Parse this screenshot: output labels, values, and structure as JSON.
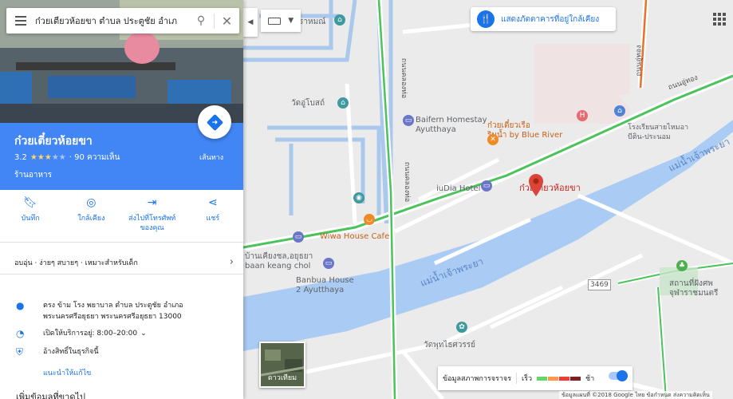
{
  "search": {
    "value": "ก๋วยเตี๋ยวห้อยขา ตำบล ประตูชัย อำเภ",
    "placeholder": ""
  },
  "place": {
    "name": "ก๋วยเตี๋ยวห้อยขา",
    "rating": "3.2",
    "stars": "★★★",
    "stars_off": "★★",
    "reviews": "· 90 ความเห็น",
    "category": "ร้านอาหาร",
    "directions_label": "เส้นทาง"
  },
  "actions": [
    {
      "label": "บันทึก",
      "icon": "bookmark-icon"
    },
    {
      "label": "ใกล้เคียง",
      "icon": "nearby-icon"
    },
    {
      "label": "ส่งไปที่โทรศัพท์ของคุณ",
      "icon": "send-to-phone-icon"
    },
    {
      "label": "แชร์",
      "icon": "share-icon"
    }
  ],
  "tags": "อบอุ่น · ง่ายๆ สบายๆ · เหมาะสำหรับเด็ก",
  "info": {
    "address": "ตรง ข้าม โรง พยาบาล ตำบล ประตูชัย อำเภอ พระนครศรีอยุธยา พระนครศรีอยุธยา 13000",
    "hours": "เปิดให้บริการอยู่: 8:00–20:00",
    "claim": "อ้างสิทธิ์ในธุรกิจนี้",
    "suggest": "แนะนำให้แก้ไข",
    "more": "เพิ่มข้อมูลที่ขาดไป"
  },
  "map": {
    "restaurants_chip": "แสดงภัตตาคารที่อยู่ใกล้เคียง",
    "satellite_label": "ดาวเทียม",
    "traffic_label": "ข้อมูลสภาพการจราจร",
    "traffic_fast": "เร็ว",
    "traffic_slow": "ช้า",
    "attribution": "ข้อมูลแผนที่ ©2018 Google   ไทย   ข้อกำหนด   ส่งความคิดเห็น",
    "labels": {
      "school_top": "ราหมณ์",
      "temple1": "วัดอู่โบสถ์",
      "baifern": "Baifern Homestay\nAyutthaya",
      "river_restaurant": "ก๋วยเตี๋ยวเรือ\nริมน้ำ by Blue River",
      "school_right": "โรงเรียนสายไหมอา\nบีติน-ประนอม",
      "iudia": "iuDia Hotel",
      "pin_label": "ก๋วยเตี๋ยวห้อยขา",
      "river_top": "แม่น้ำเจ้าพระยา",
      "river_mid": "แม่น้ำเจ้าพระยา",
      "wiwa": "Wiwa House Cafe",
      "baan_keang": "บ้านเคียงชล,อยุธยา\nbaan keang chol",
      "banbua": "Banbua House\n2 Ayutthaya",
      "temple2": "วัดพุทไธศวรรย์",
      "station": "สถานที่ฝังศพ\nจุฬาราชมนตรี",
      "road1": "ถนนคลองท่อ",
      "road2": "ถนนคลองท่อ",
      "road3": "ถนนอู่ทอง",
      "road4": "ถนนอู่ทอง",
      "route": "3469"
    }
  }
}
